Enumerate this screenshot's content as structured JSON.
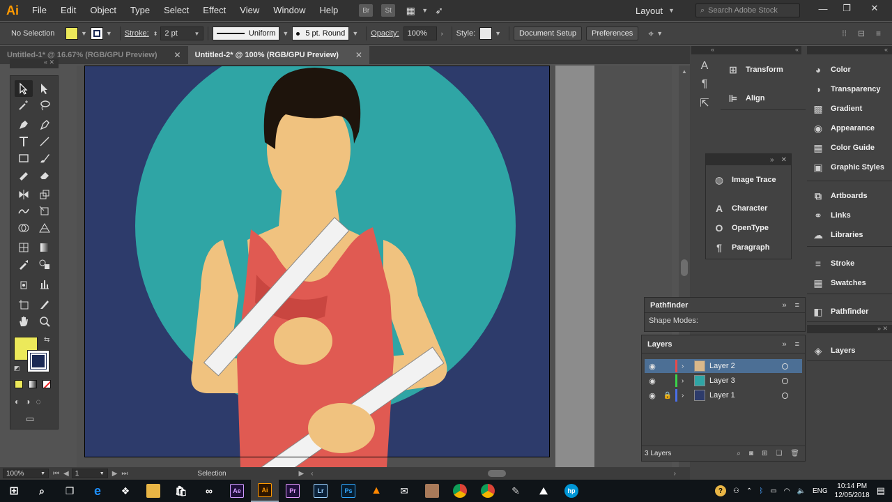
{
  "app": {
    "logo": "Ai"
  },
  "menu": [
    "File",
    "Edit",
    "Object",
    "Type",
    "Select",
    "Effect",
    "View",
    "Window",
    "Help"
  ],
  "menu_icons": [
    "Br",
    "St"
  ],
  "workspace": {
    "label": "Layout",
    "search_placeholder": "Search Adobe Stock"
  },
  "control_bar": {
    "selection": "No Selection",
    "fill_color": "#ece95a",
    "stroke_color": "#1b2a55",
    "stroke_label": "Stroke:",
    "stroke_weight": "2 pt",
    "stroke_profile": "Uniform",
    "brush": "5 pt. Round",
    "opacity_label": "Opacity:",
    "opacity": "100%",
    "style_label": "Style:",
    "document_setup": "Document Setup",
    "preferences": "Preferences"
  },
  "tabs": [
    {
      "label": "Untitled-1* @ 16.67% (RGB/GPU Preview)",
      "active": false
    },
    {
      "label": "Untitled-2* @ 100% (RGB/GPU Preview)",
      "active": true
    }
  ],
  "status_bar": {
    "zoom": "100%",
    "artboard": "1",
    "tool": "Selection"
  },
  "panels_mid": [
    {
      "label": "Transform",
      "icon": "transform-icon"
    },
    {
      "label": "Align",
      "icon": "align-icon"
    }
  ],
  "panels_float": [
    {
      "label": "Image Trace",
      "icon": "image-trace-icon"
    },
    {
      "label": "Character",
      "icon": "character-icon"
    },
    {
      "label": "OpenType",
      "icon": "opentype-icon"
    },
    {
      "label": "Paragraph",
      "icon": "paragraph-icon"
    }
  ],
  "panels_right": [
    {
      "label": "Color",
      "icon": "color-icon"
    },
    {
      "label": "Transparency",
      "icon": "transparency-icon"
    },
    {
      "label": "Gradient",
      "icon": "gradient-icon"
    },
    {
      "label": "Appearance",
      "icon": "appearance-icon"
    },
    {
      "label": "Color Guide",
      "icon": "color-guide-icon"
    },
    {
      "label": "Graphic Styles",
      "icon": "graphic-styles-icon"
    },
    {
      "label": "Artboards",
      "icon": "artboards-icon"
    },
    {
      "label": "Links",
      "icon": "links-icon"
    },
    {
      "label": "Libraries",
      "icon": "libraries-icon"
    },
    {
      "label": "Stroke",
      "icon": "stroke-icon"
    },
    {
      "label": "Swatches",
      "icon": "swatches-icon"
    },
    {
      "label": "Pathfinder",
      "icon": "pathfinder-icon"
    },
    {
      "label": "Layers",
      "icon": "layers-icon"
    }
  ],
  "pathfinder_panel": {
    "title": "Pathfinder",
    "shape_modes": "Shape Modes:"
  },
  "layers_panel": {
    "title": "Layers",
    "count": "3 Layers",
    "layers": [
      {
        "name": "Layer 2",
        "color": "#e84a4a",
        "selected": true,
        "locked": false
      },
      {
        "name": "Layer 3",
        "color": "#3ad34a",
        "selected": false,
        "locked": false
      },
      {
        "name": "Layer 1",
        "color": "#4a6fe8",
        "selected": false,
        "locked": true
      }
    ]
  },
  "taskbar": {
    "apps": [
      "Ae",
      "Ai",
      "Pr",
      "Lr",
      "Ps"
    ],
    "language": "ENG",
    "time": "10:14 PM",
    "date": "12/05/2018"
  },
  "artwork_colors": {
    "background": "#2d3b6b",
    "circle": "#2fa5a5",
    "skin": "#f0c27f",
    "skin_shadow": "#d9a762",
    "hair": "#1e140c",
    "tank_top": "#e05a52",
    "tank_shadow": "#c94640",
    "ruler": "#f2f2f2"
  }
}
